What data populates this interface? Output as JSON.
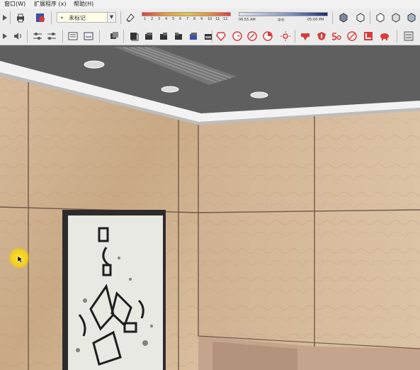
{
  "menu": {
    "window": "窗口(W)",
    "extensions": "扩展程序 (x)",
    "help": "帮助(H)"
  },
  "toolbar": {
    "style_select": "未标记",
    "month_ticks": [
      "1",
      "2",
      "3",
      "4",
      "5",
      "6",
      "7",
      "8",
      "9",
      "10",
      "11",
      "12"
    ],
    "time_start": "06:55 AM",
    "time_noon": "中午",
    "time_end": "05:00 PM"
  },
  "colors": {
    "ceiling": "#5f5f60",
    "wood_panel": "#d2b596",
    "accent_red": "#d93a3a",
    "style_field_bg": "#fffde8"
  }
}
